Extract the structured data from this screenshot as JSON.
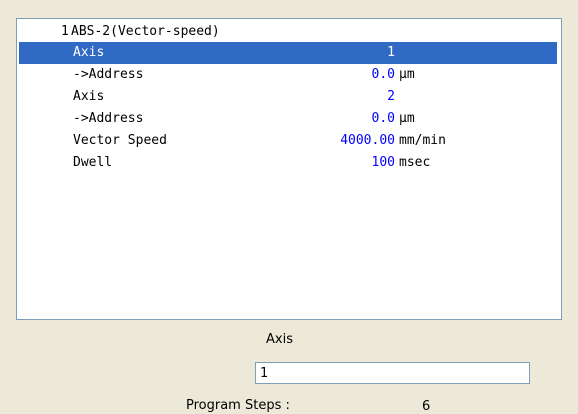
{
  "program": {
    "number": "1",
    "name": "ABS-2(Vector-speed)"
  },
  "params": [
    {
      "label": "Axis",
      "value": "1",
      "unit": "",
      "selected": true
    },
    {
      "label": "->Address",
      "value": "0.0",
      "unit": "μm",
      "selected": false
    },
    {
      "label": "Axis",
      "value": "2",
      "unit": "",
      "selected": false
    },
    {
      "label": "->Address",
      "value": "0.0",
      "unit": "μm",
      "selected": false
    },
    {
      "label": "Vector Speed",
      "value": "4000.00",
      "unit": "mm/min",
      "selected": false
    },
    {
      "label": "Dwell",
      "value": "100",
      "unit": "msec",
      "selected": false
    }
  ],
  "editor": {
    "field_label": "Axis",
    "field_value": "1",
    "steps_label": "Program Steps :",
    "steps_value": "6"
  },
  "colors": {
    "selection": "#316ac5",
    "value_text": "#0000ff",
    "background": "#ece9d8"
  }
}
